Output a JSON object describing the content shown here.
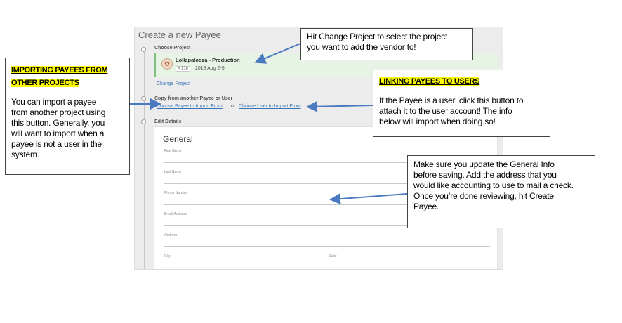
{
  "page": {
    "title": "Create a new Payee",
    "steps": {
      "choose_project": "Choose Project",
      "copy_from": "Copy from another Payee or User",
      "edit_details": "Edit Details"
    },
    "project": {
      "name": "Lollapalooza - Production",
      "number": "# 178",
      "dates": "2018 Aug 2-5"
    },
    "change_project_link": "Change Project",
    "import_payee_link": "Choose Payee to Import From",
    "or_text": "or",
    "import_user_link": "Choose User to Import From",
    "form": {
      "heading": "General",
      "fields": {
        "first_name": "First Name",
        "last_name": "Last Name",
        "phone": "Phone Number",
        "email": "Email Address",
        "address": "Address",
        "city": "City",
        "state": "State"
      }
    }
  },
  "callouts": {
    "change_project": {
      "body": "Hit Change Project to select the project\nyou want to add the vendor to!"
    },
    "importing": {
      "heading_line1": "IMPORTING PAYEES FROM",
      "heading_line2": "OTHER PROJECTS",
      "body": "You can import a payee\nfrom another project using\nthis button. Generally, you\nwill want to import when a\npayee is not a user in the\nsystem."
    },
    "linking": {
      "heading": "LINKING PAYEES TO USERS",
      "body": "If the Payee is a user, click this button to\nattach it to the user account! The info\nbelow will import when doing so!"
    },
    "general_info": {
      "body": "Make sure you update the General Info\nbefore saving. Add the address that you\nwould like accounting to use to mail a check.\nOnce you’re done reviewing, hit Create\nPayee."
    }
  },
  "colors": {
    "highlight": "#ffff00",
    "arrow": "#4a7ac0",
    "link": "#3a74b8",
    "project_card": "#e7f3e5"
  }
}
